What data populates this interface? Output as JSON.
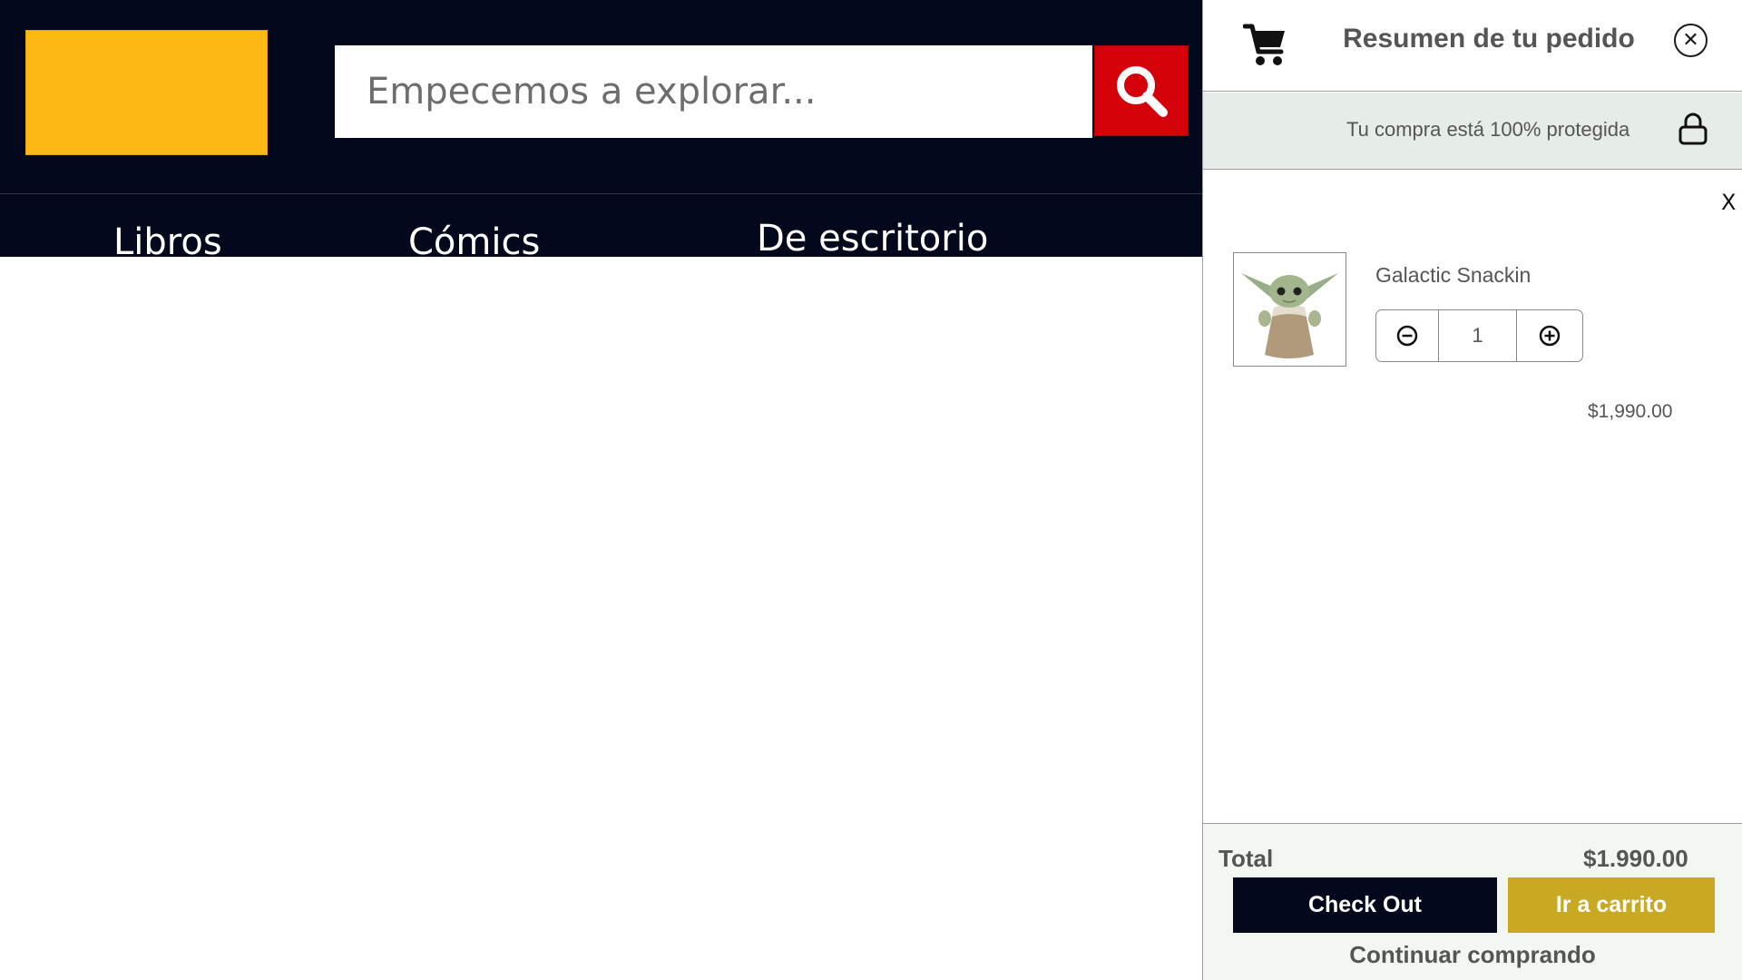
{
  "header": {
    "search": {
      "placeholder": "Empecemos a explorar...",
      "value": ""
    },
    "nav": {
      "items": [
        {
          "label": "Libros"
        },
        {
          "label": "Cómics"
        },
        {
          "label": "De escritorio"
        }
      ]
    }
  },
  "cart": {
    "title": "Resumen de tu pedido",
    "protection_text": "Tu compra está 100% protegida",
    "remove_label": "X",
    "items": [
      {
        "name": "Galactic Snackin",
        "quantity": "1",
        "price": "$1,990.00"
      }
    ],
    "total_label": "Total",
    "total_value": "$1.990.00",
    "checkout_label": "Check Out",
    "go_to_cart_label": "Ir a carrito",
    "continue_label": "Continuar comprando"
  },
  "colors": {
    "header_bg": "#03081d",
    "logo": "#fdb813",
    "search_button": "#d4000a",
    "checkout_bg": "#03081d",
    "go_to_cart_bg": "#c9a822",
    "protect_bar_bg": "#e6ede9",
    "footer_bg": "#f3f7f1"
  },
  "icons": {
    "search": "search-icon",
    "cart": "shopping-cart-icon",
    "close": "close-icon",
    "lock": "lock-icon",
    "minus": "minus-circle-icon",
    "plus": "plus-circle-icon"
  }
}
